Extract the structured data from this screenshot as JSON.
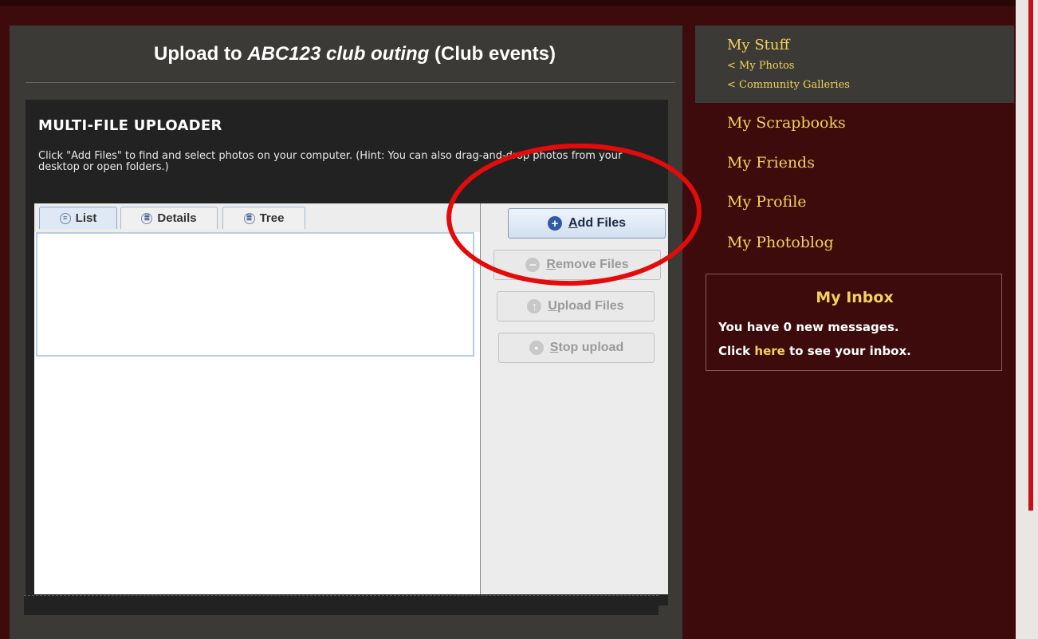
{
  "main": {
    "title_prefix": "Upload to ",
    "title_album": "ABC123 club outing",
    "title_suffix": " (Club events)"
  },
  "uploader": {
    "heading": "MULTI-FILE UPLOADER",
    "hint": "Click \"Add Files\" to find and select photos on your computer. (Hint: You can also drag-and-drop photos from your desktop or open folders.)",
    "tabs": [
      {
        "label": "List",
        "icon": "list-icon",
        "active": true
      },
      {
        "label": "Details",
        "icon": "details-icon",
        "active": false
      },
      {
        "label": "Tree",
        "icon": "tree-icon",
        "active": false
      }
    ],
    "buttons": {
      "add_mnemonic": "A",
      "add_rest": "dd Files",
      "remove_mnemonic": "R",
      "remove_rest": "emove Files",
      "upload_mnemonic": "U",
      "upload_rest": "pload Files",
      "stop_mnemonic": "S",
      "stop_rest": "top upload"
    }
  },
  "sidebar": {
    "my_stuff": "My Stuff",
    "my_photos": "< My Photos",
    "community_galleries": "< Community Galleries",
    "nav": [
      "My Scrapbooks",
      "My Friends",
      "My Profile",
      "My Photoblog"
    ]
  },
  "inbox": {
    "title": "My Inbox",
    "line1_pre": "You have ",
    "line1_count": "0",
    "line1_post": " new messages.",
    "line2_pre": "Click ",
    "line2_link": "here",
    "line2_post": " to see your inbox."
  },
  "colors": {
    "background": "#3d0b0b",
    "panel": "#3c3a36",
    "accent_gold": "#f3d35a",
    "annotation_red": "#e40b0b"
  }
}
